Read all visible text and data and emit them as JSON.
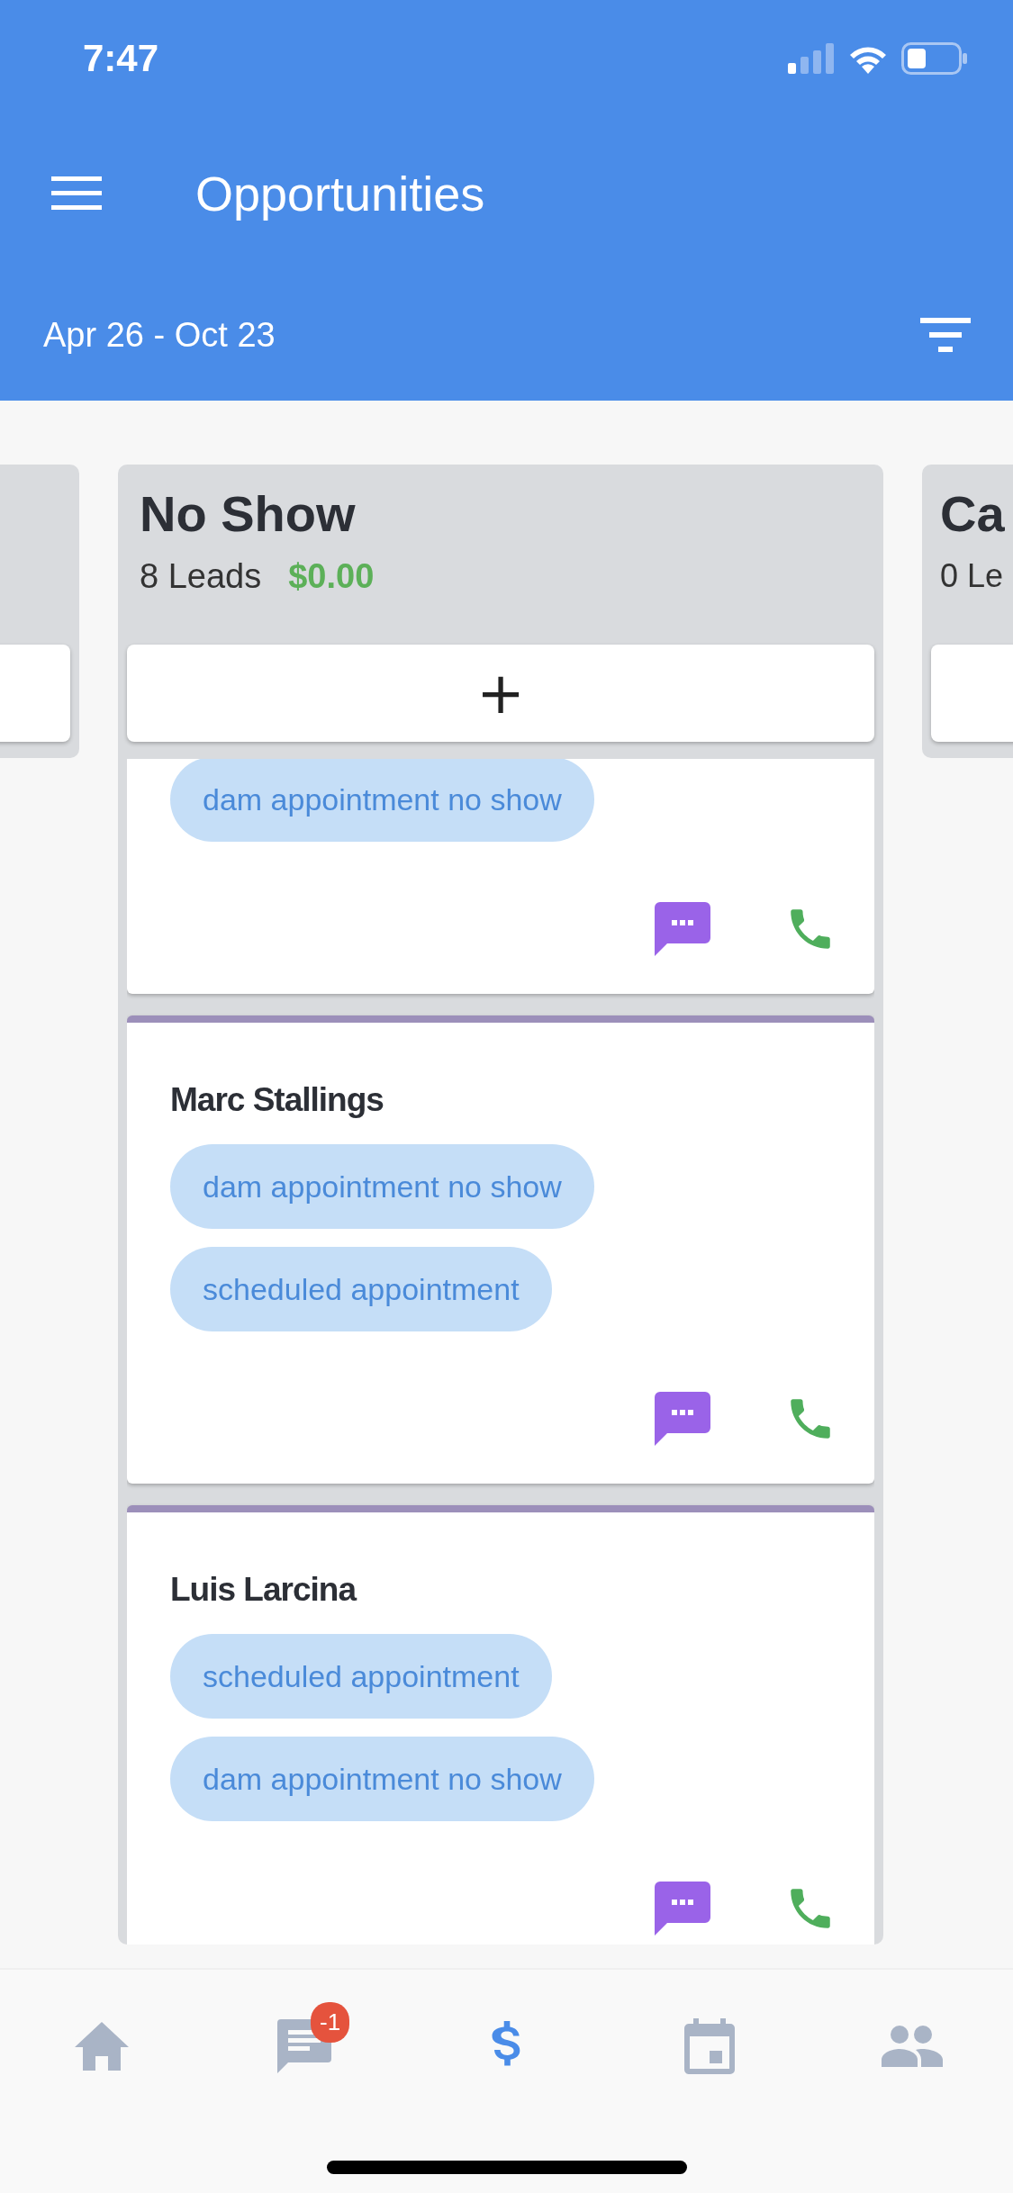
{
  "status_bar": {
    "time": "7:47"
  },
  "header": {
    "title": "Opportunities",
    "date_range": "Apr 26 - Oct 23"
  },
  "columns": [
    {
      "kind": "edge"
    },
    {
      "kind": "full",
      "title": "No Show",
      "leads": "8 Leads",
      "amount": "$0.00",
      "add_label": "+",
      "cards": [
        {
          "tags": [
            "dam appointment no show"
          ]
        },
        {
          "name": "Marc Stallings",
          "tags": [
            "dam appointment no show",
            "scheduled appointment"
          ]
        },
        {
          "name": "Luis Larcina",
          "tags": [
            "scheduled appointment",
            "dam appointment no show"
          ]
        }
      ]
    },
    {
      "kind": "edge",
      "title": "Ca",
      "leads": "0 Le"
    }
  ],
  "tabs": [
    {
      "kind": "home",
      "selected": false
    },
    {
      "kind": "messages",
      "selected": false,
      "badge": "-1"
    },
    {
      "kind": "dollar",
      "selected": true
    },
    {
      "kind": "calendar",
      "selected": false
    },
    {
      "kind": "contacts",
      "selected": false
    }
  ]
}
